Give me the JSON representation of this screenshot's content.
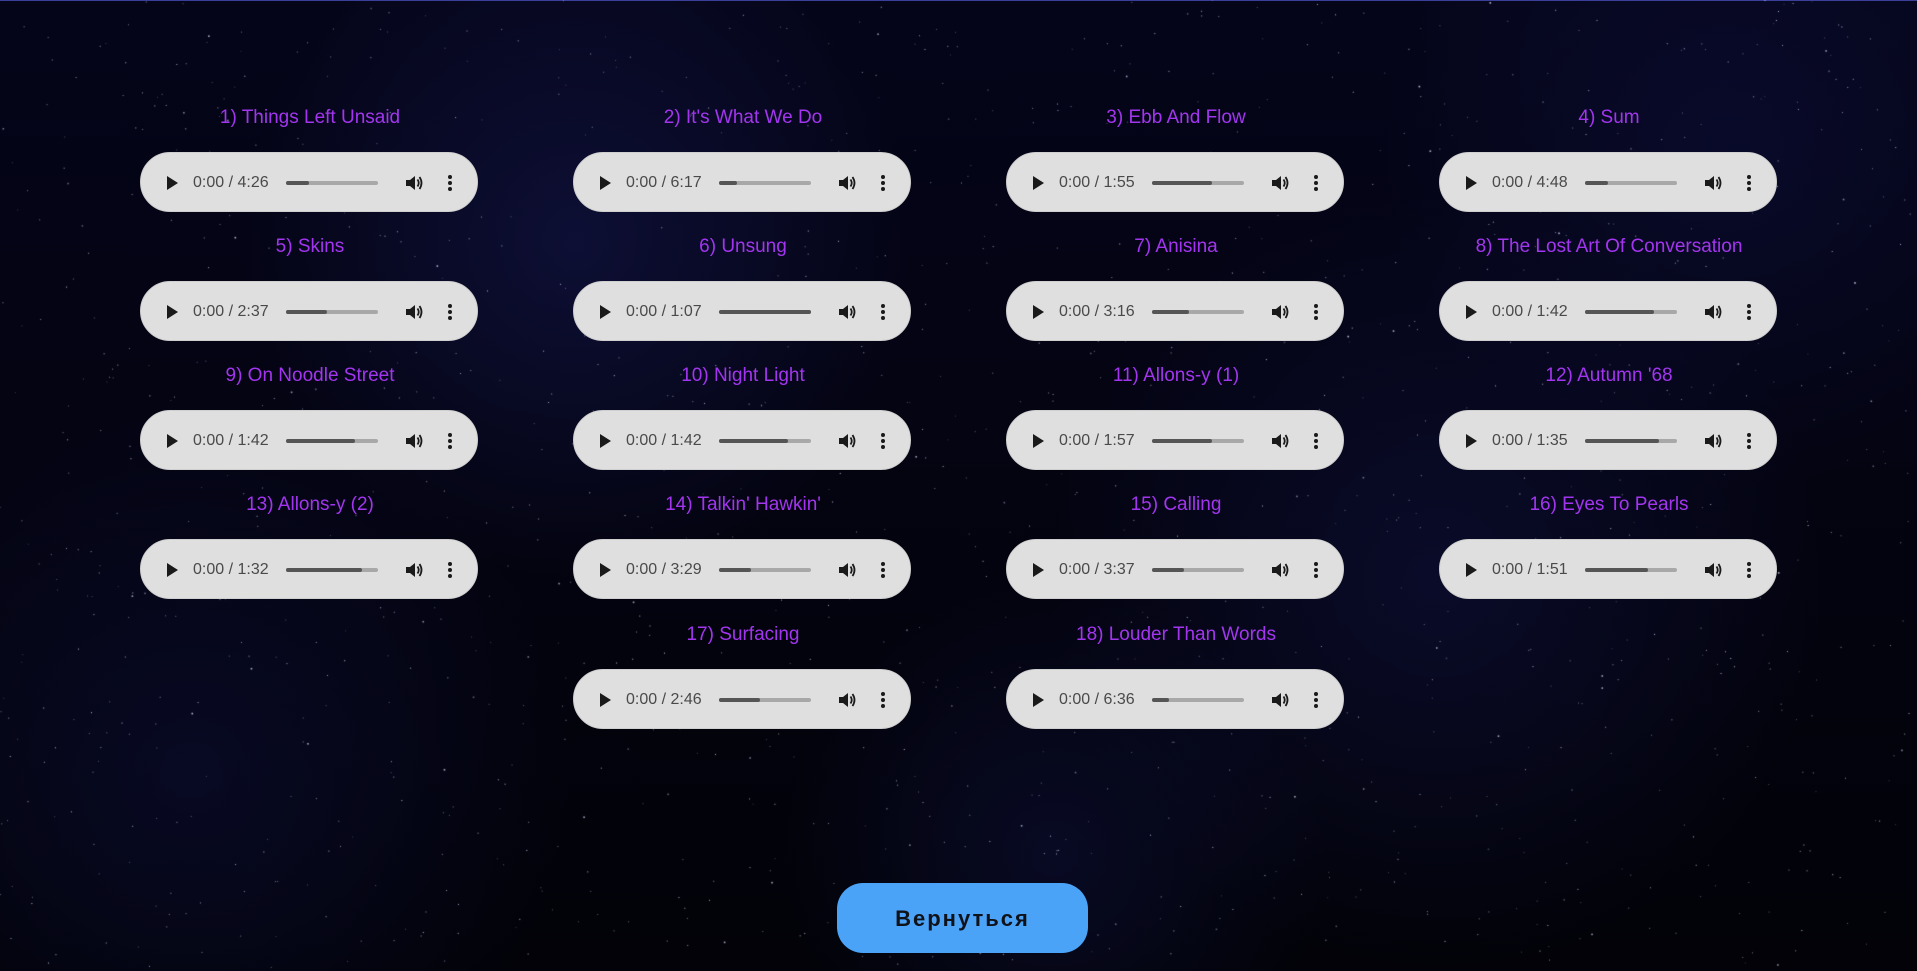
{
  "page": {
    "back_button_label": "Вернуться",
    "colors": {
      "title": "#a335f0",
      "player_bg": "#dfdfdf",
      "button_bg": "#4aa3f7",
      "background": "#03030d"
    }
  },
  "tracks": [
    {
      "title": "1) Things Left Unsaid",
      "time": "0:00 / 4:26",
      "volume_level": 0.25
    },
    {
      "title": "2) It's What We Do",
      "time": "0:00 / 6:17",
      "volume_level": 0.2
    },
    {
      "title": "3) Ebb And Flow",
      "time": "0:00 / 1:55",
      "volume_level": 0.65
    },
    {
      "title": "4) Sum",
      "time": "0:00 / 4:48",
      "volume_level": 0.25
    },
    {
      "title": "5) Skins",
      "time": "0:00 / 2:37",
      "volume_level": 0.45
    },
    {
      "title": "6) Unsung",
      "time": "0:00 / 1:07",
      "volume_level": 1.0
    },
    {
      "title": "7) Anisina",
      "time": "0:00 / 3:16",
      "volume_level": 0.4
    },
    {
      "title": "8) The Lost Art Of Conversation",
      "time": "0:00 / 1:42",
      "volume_level": 0.75
    },
    {
      "title": "9) On Noodle Street",
      "time": "0:00 / 1:42",
      "volume_level": 0.75
    },
    {
      "title": "10) Night Light",
      "time": "0:00 / 1:42",
      "volume_level": 0.75
    },
    {
      "title": "11) Allons-y (1)",
      "time": "0:00 / 1:57",
      "volume_level": 0.65
    },
    {
      "title": "12) Autumn '68",
      "time": "0:00 / 1:35",
      "volume_level": 0.8
    },
    {
      "title": "13) Allons-y (2)",
      "time": "0:00 / 1:32",
      "volume_level": 0.83
    },
    {
      "title": "14) Talkin' Hawkin'",
      "time": "0:00 / 3:29",
      "volume_level": 0.35
    },
    {
      "title": "15) Calling",
      "time": "0:00 / 3:37",
      "volume_level": 0.35
    },
    {
      "title": "16) Eyes To Pearls",
      "time": "0:00 / 1:51",
      "volume_level": 0.68
    },
    {
      "title": "17) Surfacing",
      "time": "0:00 / 2:46",
      "volume_level": 0.45
    },
    {
      "title": "18) Louder Than Words",
      "time": "0:00 / 6:36",
      "volume_level": 0.18
    }
  ]
}
